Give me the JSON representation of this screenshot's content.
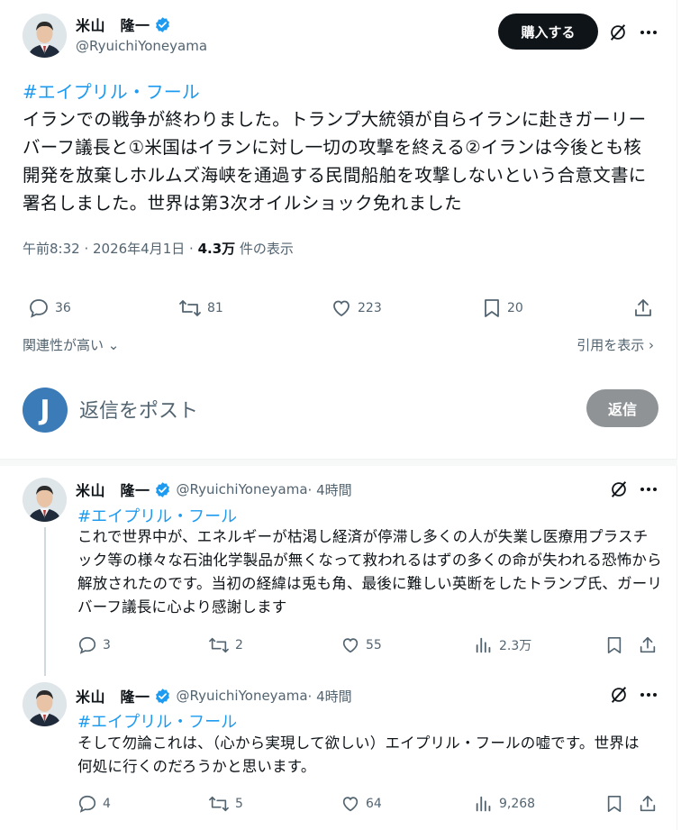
{
  "main_post": {
    "author_name": "米山　隆一",
    "handle": "@RyuichiYoneyama",
    "buy_label": "購入する",
    "hashtag": "#エイプリル・フール",
    "text": "イランでの戦争が終わりました。トランプ大統領が自らイランに赴きガーリーバーフ議長と①米国はイランに対し一切の攻撃を終える②イランは今後とも核開発を放棄しホルムズ海峡を通過する民間船舶を攻撃しないという合意文書に署名しました。世界は第3次オイルショック免れました",
    "timestamp": "午前8:32 · 2026年4月1日 · ",
    "views_count": "4.3万",
    "views_label": " 件の表示",
    "stats": {
      "replies": "36",
      "reposts": "81",
      "likes": "223",
      "bookmarks": "20"
    },
    "relevance_label": "関連性が高い",
    "quotes_label": "引用を表示"
  },
  "compose": {
    "avatar_letter": "J",
    "placeholder": "返信をポスト",
    "reply_label": "返信"
  },
  "replies": [
    {
      "author_name": "米山　隆一",
      "handle": "@RyuichiYoneyama",
      "time": " · 4時間",
      "hashtag": "#エイプリル・フール",
      "text": "これで世界中が、エネルギーが枯渇し経済が停滞し多くの人が失業し医療用プラスチック等の様々な石油化学製品が無くなって救われるはずの多くの命が失われる恐怖から解放されたのです。当初の経緯は兎も角、最後に難しい英断をしたトランプ氏、ガーリバーフ議長に心より感謝します",
      "stats": {
        "replies": "3",
        "reposts": "2",
        "likes": "55",
        "views": "2.3万"
      }
    },
    {
      "author_name": "米山　隆一",
      "handle": "@RyuichiYoneyama",
      "time": " · 4時間",
      "hashtag": "#エイプリル・フール",
      "text": "そして勿論これは、（心から実現して欲しい）エイプリル・フールの嘘です。世界は何処に行くのだろうかと思います。",
      "stats": {
        "replies": "4",
        "reposts": "5",
        "likes": "64",
        "views": "9,268"
      }
    }
  ],
  "colors": {
    "link": "#1d9bf0",
    "verified": "#1d9bf0",
    "muted": "#536471",
    "compose_avatar": "#3a7bb8"
  },
  "icons": [
    "verified-badge-icon",
    "grok-icon",
    "more-icon",
    "reply-icon",
    "repost-icon",
    "like-icon",
    "bookmark-icon",
    "share-icon",
    "views-icon",
    "chevron-down-icon",
    "chevron-right-icon"
  ]
}
